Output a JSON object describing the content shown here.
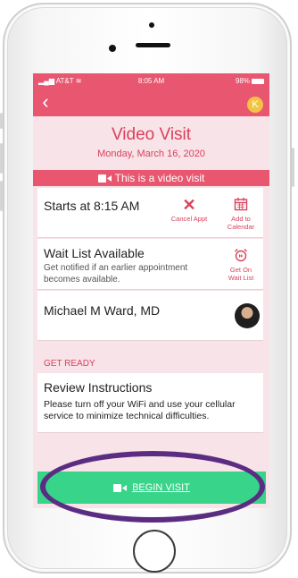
{
  "status_bar": {
    "carrier": "AT&T",
    "time": "8:05 AM",
    "battery": "98%"
  },
  "nav": {
    "avatar_initial": "K"
  },
  "header": {
    "title": "Video Visit",
    "date": "Monday, March 16, 2020"
  },
  "banner": {
    "text": "This is a video visit"
  },
  "appointment": {
    "starts": "Starts at 8:15 AM",
    "cancel_label": "Cancel Appt",
    "calendar_label_1": "Add to",
    "calendar_label_2": "Calendar"
  },
  "wait_list": {
    "title": "Wait List Available",
    "description": "Get notified if an earlier appointment becomes available.",
    "action_label_1": "Get On",
    "action_label_2": "Wait List"
  },
  "provider": {
    "name": "Michael M Ward, MD"
  },
  "get_ready": {
    "heading": "GET READY",
    "title": "Review Instructions",
    "text": "Please turn off your WiFi and use your cellular service to minimize technical difficulties."
  },
  "begin": {
    "label": "BEGIN VISIT"
  },
  "colors": {
    "primary": "#e9566f",
    "accent_text": "#d9415c",
    "begin_button": "#37d489",
    "highlight": "#5a2d82"
  }
}
